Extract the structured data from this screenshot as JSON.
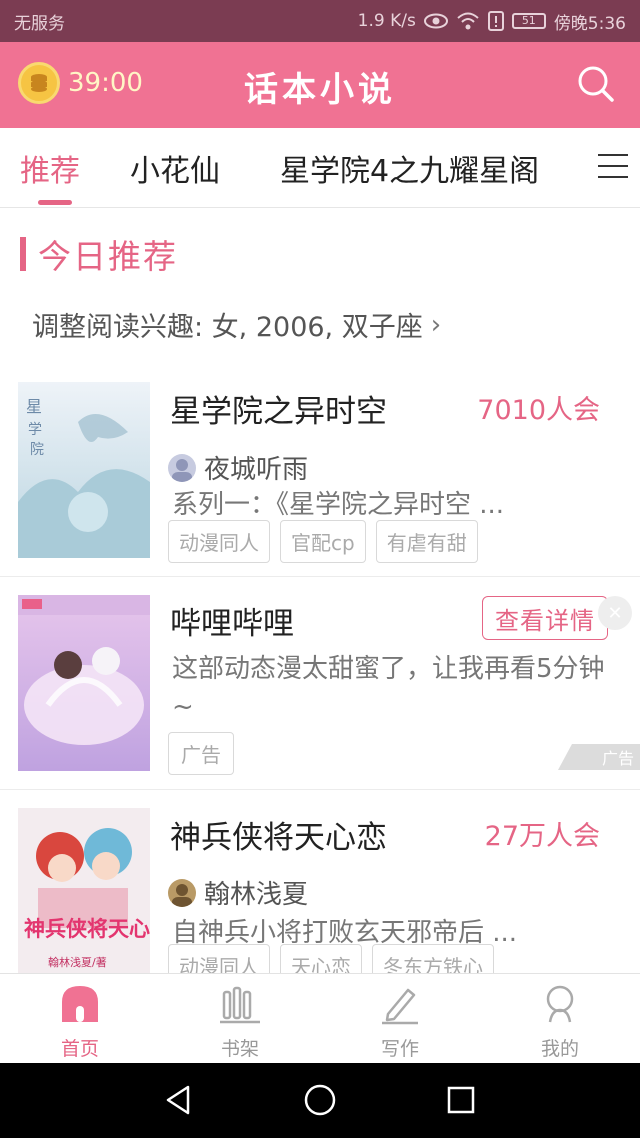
{
  "status_bar": {
    "carrier": "无服务",
    "speed": "1.9 K/s",
    "battery": "51",
    "time": "傍晚5:36"
  },
  "app_header": {
    "timer": "39:00",
    "title": "话本小说",
    "icons": {
      "timer": "coin-stack-icon",
      "search": "search-icon"
    }
  },
  "tabs": {
    "items": [
      "推荐",
      "小花仙",
      "星学院4之九耀星阁"
    ],
    "active_index": 0,
    "menu_icon": "hamburger-menu-icon"
  },
  "section": {
    "title": "今日推荐",
    "interest": "调整阅读兴趣: 女, 2006, 双子座",
    "interest_chevron": "›"
  },
  "cards": [
    {
      "title": "星学院之异时空",
      "popularity": "7010人会",
      "author": "夜城听雨",
      "description": "系列一：《星学院之异时空 ...",
      "tags": [
        "动漫同人",
        "官配cp",
        "有虐有甜"
      ]
    },
    {
      "title": "神兵侠将天心恋",
      "popularity": "27万人会",
      "author": "翰林浅夏",
      "description": "自神兵小将打败玄天邪帝后 ...",
      "tags": [
        "动漫同人",
        "天心恋",
        "冬东方铁心"
      ],
      "cover_text": "神兵侠将天心恋",
      "cover_author": "翰林浅夏/著"
    }
  ],
  "ad": {
    "title": "哔哩哔哩",
    "button": "查看详情",
    "close": "✕",
    "description": "这部动态漫太甜蜜了，让我再看5分钟~",
    "tag": "广告",
    "mark": "广告"
  },
  "bottom_nav": {
    "items": [
      {
        "label": "首页",
        "icon": "home-icon"
      },
      {
        "label": "书架",
        "icon": "bookshelf-icon"
      },
      {
        "label": "写作",
        "icon": "pencil-icon"
      },
      {
        "label": "我的",
        "icon": "profile-icon"
      }
    ],
    "active_index": 0
  },
  "colors": {
    "accent": "#e56585",
    "header": "#f07293",
    "status_bar": "#7b3c52"
  }
}
